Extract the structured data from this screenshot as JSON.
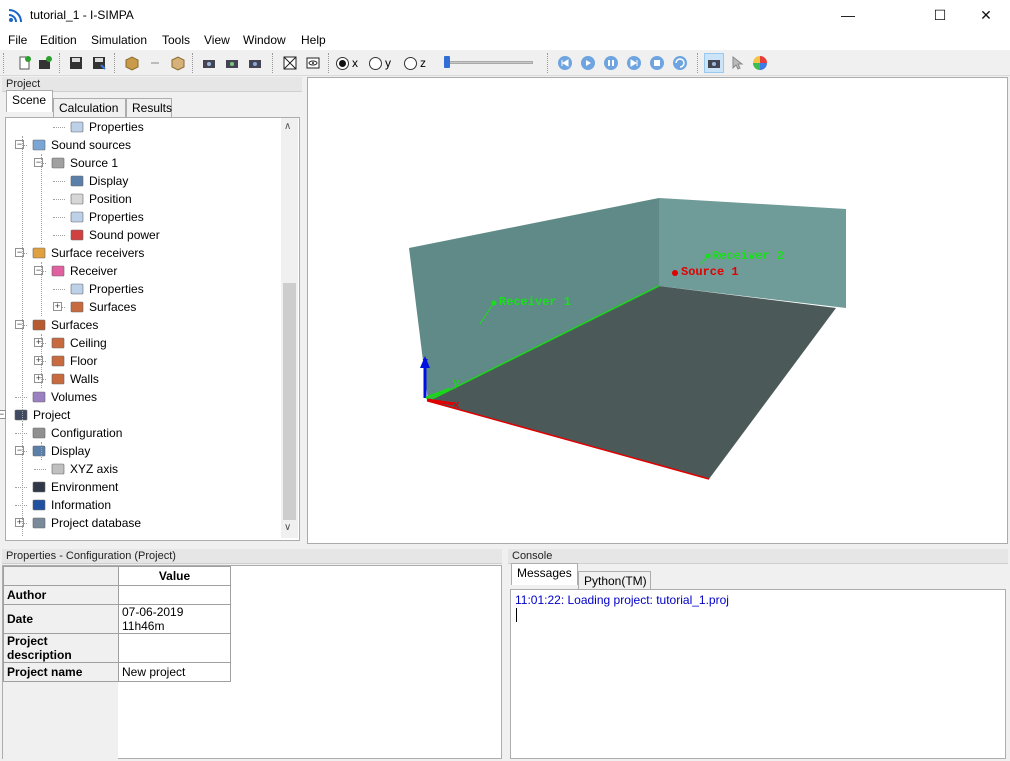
{
  "window": {
    "title": "tutorial_1 - I-SIMPA",
    "minimize": "—",
    "maximize": "☐",
    "close": "✕"
  },
  "menu": [
    "File",
    "Edition",
    "Simulation",
    "Tools",
    "View",
    "Window",
    "Help"
  ],
  "toolbar": {
    "axes": [
      {
        "label": "x",
        "selected": true
      },
      {
        "label": "y",
        "selected": false
      },
      {
        "label": "z",
        "selected": false
      }
    ],
    "slider_value": 0.0
  },
  "project_pane": {
    "title": "Project",
    "tabs": [
      "Scene",
      "Calculation",
      "Results"
    ],
    "active_tab": "Scene",
    "tree": [
      {
        "label": "Properties",
        "level": 3,
        "icon": "properties-icon"
      },
      {
        "label": "Sound sources",
        "level": 1,
        "icon": "sound-sources-icon",
        "expander": "−"
      },
      {
        "label": "Source 1",
        "level": 2,
        "icon": "speaker-icon",
        "expander": "−"
      },
      {
        "label": "Display",
        "level": 3,
        "icon": "display-icon"
      },
      {
        "label": "Position",
        "level": 3,
        "icon": "position-icon"
      },
      {
        "label": "Properties",
        "level": 3,
        "icon": "properties-icon"
      },
      {
        "label": "Sound power",
        "level": 3,
        "icon": "bar-chart-icon"
      },
      {
        "label": "Surface receivers",
        "level": 1,
        "icon": "surface-receivers-icon",
        "expander": "−"
      },
      {
        "label": "Receiver",
        "level": 2,
        "icon": "color-wheel-icon",
        "expander": "−"
      },
      {
        "label": "Properties",
        "level": 3,
        "icon": "properties-icon"
      },
      {
        "label": "Surfaces",
        "level": 3,
        "icon": "surface-icon",
        "expander": "+"
      },
      {
        "label": "Surfaces",
        "level": 1,
        "icon": "surfaces-group-icon",
        "expander": "−"
      },
      {
        "label": "Ceiling",
        "level": 2,
        "icon": "surface-icon",
        "expander": "+"
      },
      {
        "label": "Floor",
        "level": 2,
        "icon": "surface-icon",
        "expander": "+"
      },
      {
        "label": "Walls",
        "level": 2,
        "icon": "surface-icon",
        "expander": "+"
      },
      {
        "label": "Volumes",
        "level": 1,
        "icon": "volumes-icon"
      },
      {
        "label": "Project",
        "level": 0,
        "icon": "project-icon",
        "expander": "−"
      },
      {
        "label": "Configuration",
        "level": 1,
        "icon": "configuration-icon"
      },
      {
        "label": "Display",
        "level": 1,
        "icon": "display-icon",
        "expander": "−"
      },
      {
        "label": "XYZ axis",
        "level": 2,
        "icon": "axis-icon"
      },
      {
        "label": "Environment",
        "level": 1,
        "icon": "environment-icon"
      },
      {
        "label": "Information",
        "level": 1,
        "icon": "info-icon"
      },
      {
        "label": "Project database",
        "level": 1,
        "icon": "database-icon",
        "expander": "+"
      }
    ]
  },
  "viewport": {
    "labels": {
      "receiver1": "Receiver 1",
      "receiver2": "Receiver 2",
      "source1": "Source 1",
      "axis_x": "x",
      "axis_y": "y",
      "axis_z": "z"
    }
  },
  "properties_pane": {
    "title": "Properties - Configuration (Project)",
    "value_header": "Value",
    "rows": [
      {
        "name": "Author",
        "value": ""
      },
      {
        "name": "Date",
        "value": "07-06-2019 11h46m"
      },
      {
        "name": "Project description",
        "value": ""
      },
      {
        "name": "Project name",
        "value": "New project"
      }
    ]
  },
  "console_pane": {
    "title": "Console",
    "tabs": [
      "Messages",
      "Python(TM)"
    ],
    "active_tab": "Messages",
    "messages": [
      "11:01:22: Loading project: tutorial_1.proj"
    ]
  },
  "colors": {
    "wall": "#5f8a88",
    "wall_right": "#6f9b99",
    "floor": "#4b5a58",
    "source_label": "#e00000",
    "receiver_label": "#18e018",
    "axis_x": "#e00000",
    "axis_y": "#18d818",
    "axis_z": "#0010e0",
    "console_text": "#0000c8"
  }
}
